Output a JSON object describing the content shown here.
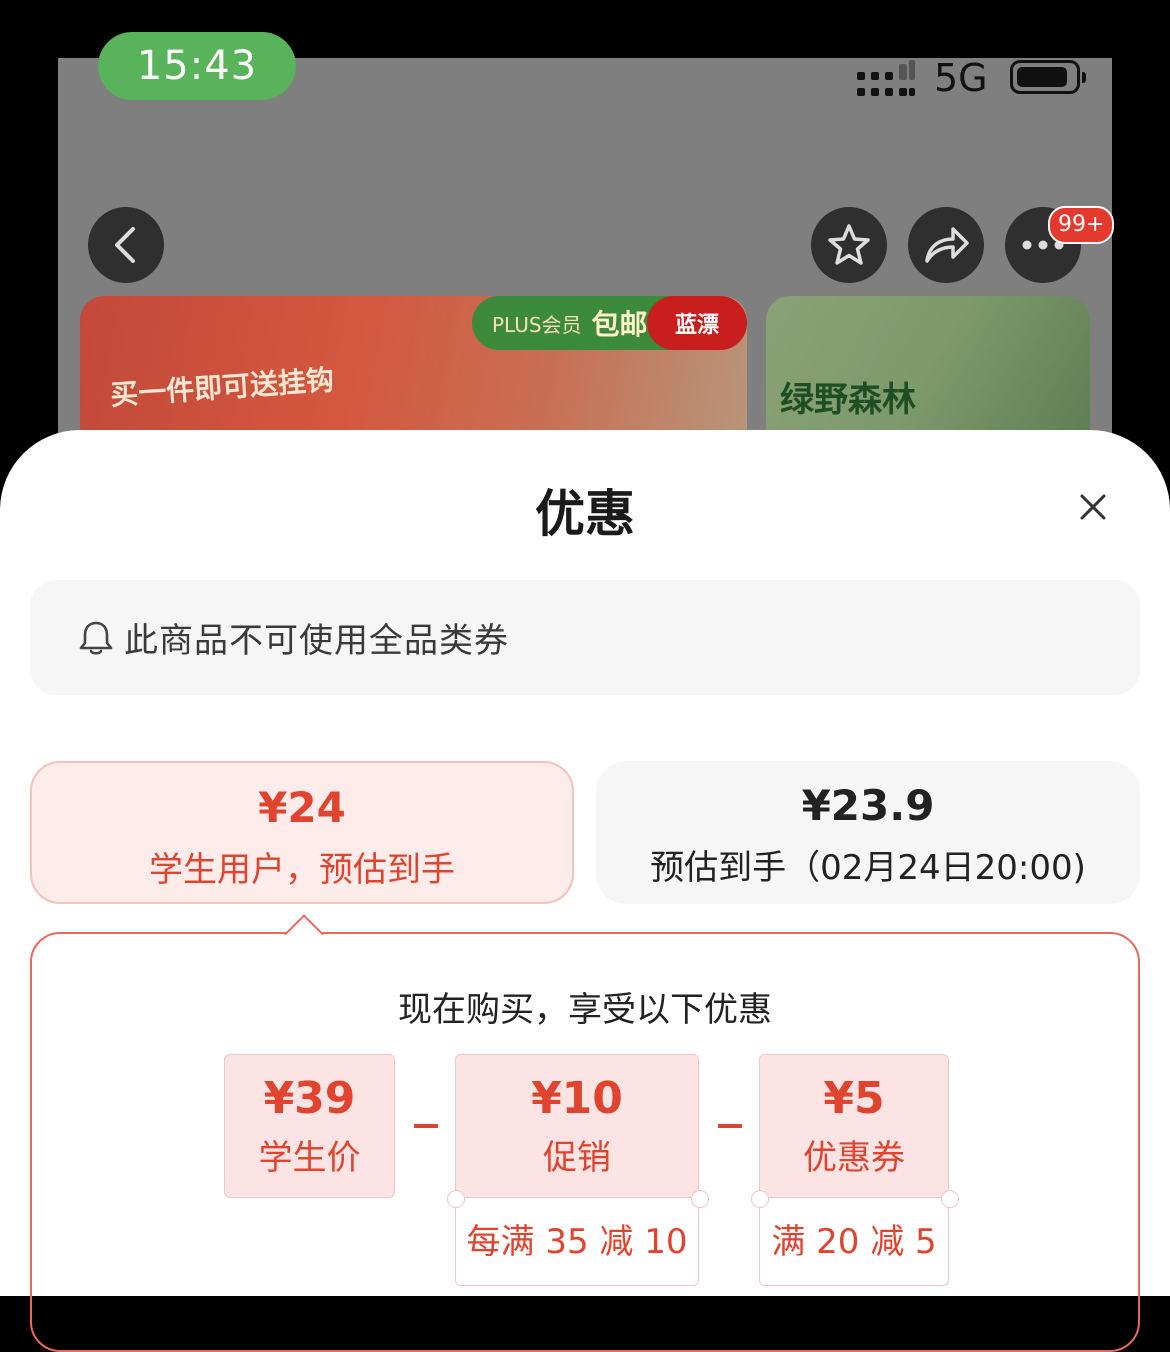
{
  "status_bar": {
    "time": "15:43",
    "network": "5G"
  },
  "header": {
    "badge": "99+"
  },
  "banner_left": {
    "promo": "买一件即可送挂钩",
    "plus": "PLUS会员",
    "free_shipping": "包邮",
    "brand": "蓝漂"
  },
  "banner_right": {
    "title": "绿野森林"
  },
  "sheet": {
    "title": "优惠",
    "notice": "此商品不可使用全品类券",
    "price_options": [
      {
        "amount": "¥24",
        "desc": "学生用户，预估到手",
        "selected": true
      },
      {
        "amount": "¥23.9",
        "desc": "预估到手（02月24日20:00)",
        "selected": false
      }
    ],
    "detail": {
      "heading": "现在购买，享受以下优惠",
      "items": [
        {
          "value": "¥39",
          "label": "学生价"
        },
        {
          "value": "¥10",
          "label": "促销",
          "condition": "每满 35 减 10"
        },
        {
          "value": "¥5",
          "label": "优惠券",
          "condition": "满 20 减 5"
        }
      ]
    }
  },
  "colors": {
    "accent": "#e1442e",
    "status_pill": "#58b35a"
  }
}
